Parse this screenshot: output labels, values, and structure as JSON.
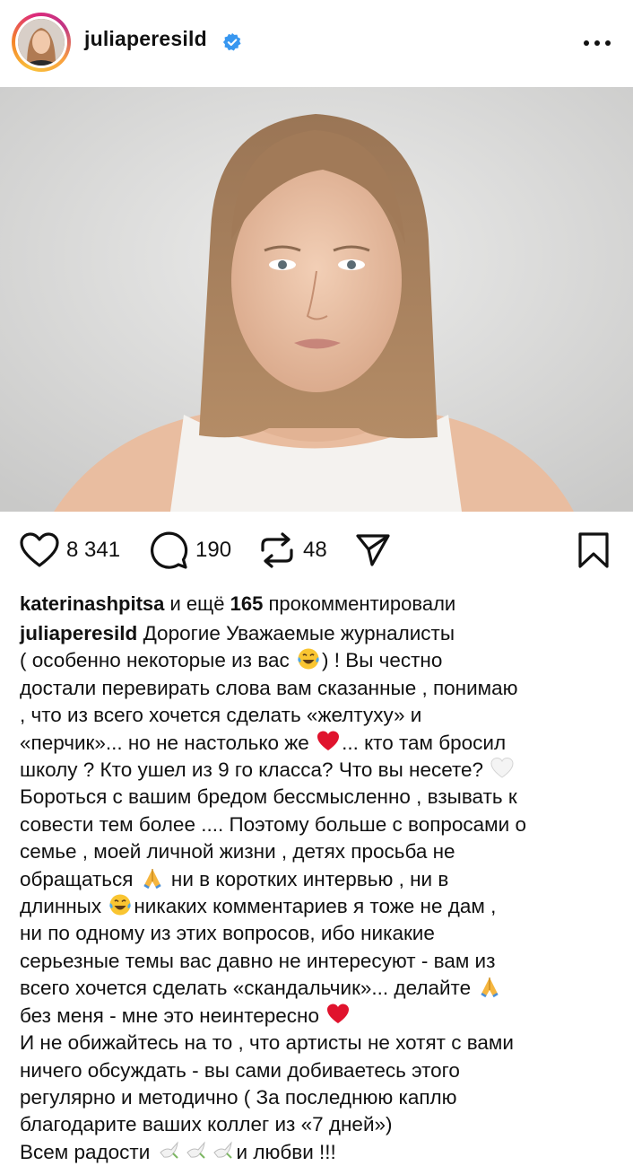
{
  "post": {
    "username": "juliaperesild",
    "icons": [
      "verified-badge-icon",
      "more-options-icon",
      "heart-icon",
      "comment-icon",
      "repost-icon",
      "share-icon",
      "bookmark-icon"
    ]
  },
  "stats": {
    "likes": "8 341",
    "comments": "190",
    "reposts": "48"
  },
  "comments_summary": {
    "user": "katerinashpitsa",
    "mid": " и ещё ",
    "count": "165",
    "tail": " прокомментировали"
  },
  "caption": {
    "author": "juliaperesild",
    "l1": " Дорогие Уважаемые журналисты",
    "l2a": "( особенно некоторые из вас ",
    "l2b": ") ! Вы честно",
    "l3": "достали перевирать слова вам  сказанные , понимаю",
    "l4": ", что из всего хочется сделать «желтуху» и",
    "l5a": "«перчик»... но не настолько же ",
    "l5b": "... кто там бросил",
    "l6a": "школу ? Кто ушел из 9 го класса? Что вы несете? ",
    "l7": "Бороться с вашим бредом бессмысленно , взывать к",
    "l8": "совести тем более .... Поэтому больше с вопросами о",
    "l9": "семье , моей личной жизни , детях просьба не",
    "l10a": "обращаться ",
    "l10b": " ни в коротких интервью , ни в",
    "l11a": "длинных ",
    "l11b": "никаких комментариев я тоже не дам ,",
    "l12": "ни по одному из этих вопросов, ибо никакие",
    "l13": "серьезные темы вас давно не интересуют - вам из",
    "l14a": "всего хочется сделать «скандальчик»... делайте ",
    "l15a": "без меня - мне это неинтересно ",
    "l16": "И не обижайтесь на то , что артисты не хотят с вами",
    "l17": "ничего обсуждать - вы сами добиваетесь этого",
    "l18": "регулярно и методично ( За последнюю каплю",
    "l19": "благодарите ваших коллег из «7 дней»)",
    "l20a": "Всем радости ",
    "l20b": "и любви !!!"
  },
  "colors": {
    "verified": "#3897f0",
    "heart": "#e0132d",
    "text": "#111111"
  }
}
